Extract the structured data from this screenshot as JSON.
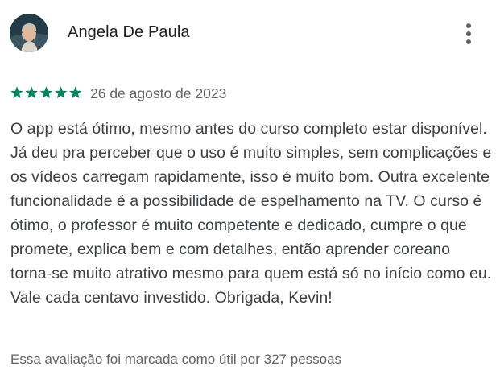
{
  "review": {
    "reviewer_name": "Angela De Paula",
    "rating": 5,
    "rating_max": 5,
    "date": "26 de agosto de 2023",
    "body": "O app está ótimo, mesmo antes do curso completo estar disponível. Já deu pra perceber que o uso é muito simples, sem complicações e os vídeos carregam rapidamente, isso é muito bom. Outra excelente funcionalidade é a possibilidade de espelhamento na TV. O curso é ótimo, o professor é muito competente e dedicado, cumpre o que promete, explica bem e com detalhes, então aprender coreano torna-se muito atrativo mesmo para quem está só no início como eu. Vale cada centavo investido. Obrigada, Kevin!",
    "helpful_text": "Essa avaliação foi marcada como útil por 327 pessoas"
  },
  "icons": {
    "more": "more-vert-icon",
    "star": "star-icon",
    "avatar": "avatar"
  },
  "colors": {
    "star": "#01875f",
    "name": "#202124",
    "body": "#3c4043",
    "secondary": "#5f6368",
    "more_dots": "#5f6368"
  }
}
